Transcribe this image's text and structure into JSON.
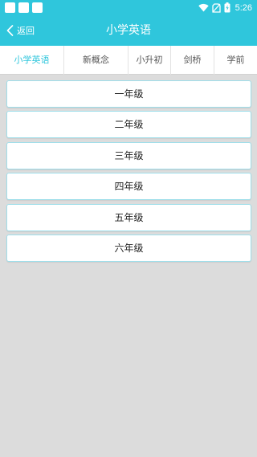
{
  "status_bar": {
    "time": "5:26",
    "icons": [
      "app-notification-icon",
      "app-notification-icon",
      "app-notification-icon",
      "wifi-icon",
      "no-sim-icon",
      "battery-charging-icon"
    ]
  },
  "header": {
    "back_label": "返回",
    "title": "小学英语"
  },
  "tabs": [
    {
      "label": "小学英语",
      "active": true
    },
    {
      "label": "新概念",
      "active": false
    },
    {
      "label": "小升初",
      "active": false
    },
    {
      "label": "剑桥",
      "active": false
    },
    {
      "label": "学前",
      "active": false
    }
  ],
  "grades": [
    {
      "label": "一年级"
    },
    {
      "label": "二年级"
    },
    {
      "label": "三年级"
    },
    {
      "label": "四年级"
    },
    {
      "label": "五年级"
    },
    {
      "label": "六年级"
    }
  ],
  "colors": {
    "accent": "#2fc6dc",
    "background": "#dcdcdc",
    "card_border": "#9fdeea"
  }
}
